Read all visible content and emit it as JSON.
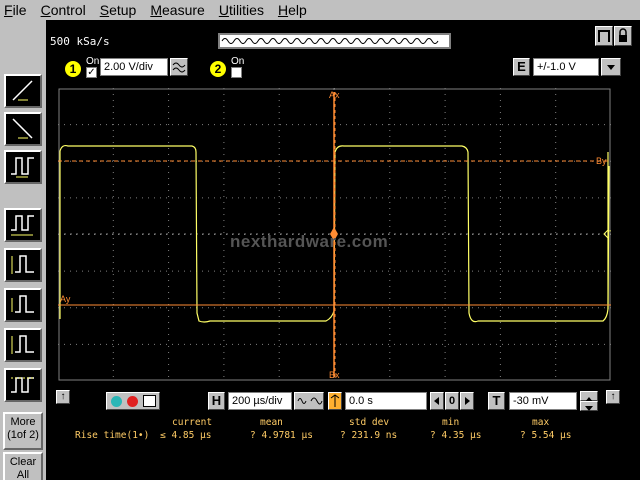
{
  "menu": {
    "file": "File",
    "file_u": "F",
    "control": "Control",
    "control_u": "C",
    "setup": "Setup",
    "setup_u": "S",
    "measure": "Measure",
    "measure_u": "M",
    "utilities": "Utilities",
    "utilities_u": "U",
    "help": "Help",
    "help_u": "H"
  },
  "sample_rate": "500 kSa/s",
  "channel1": {
    "number": "1",
    "on_label": "On",
    "checked": "✓",
    "scale": "2.00 V/div"
  },
  "channel2": {
    "number": "2",
    "on_label": "On"
  },
  "ext_trigger": {
    "button": "E",
    "value": "+/-1.0 V"
  },
  "scope_labels": {
    "ax": "Ax",
    "bx": "Bx",
    "ay": "Ay",
    "by": "By",
    "trig": "T"
  },
  "watermark": "nexthardware.com",
  "timebase": {
    "h_button": "H",
    "scale": "200 µs/div",
    "delay": "0.0 s",
    "zero": "0"
  },
  "trigger": {
    "t_button": "T",
    "level": "-30 mV"
  },
  "left_buttons": {
    "more": "More",
    "more_sub": "(1of 2)",
    "clear": "Clear",
    "clear_sub": "All",
    "up_arrow": "↑"
  },
  "stats": {
    "headers": {
      "current": "current",
      "mean": "mean",
      "std_dev": "std dev",
      "min": "min",
      "max": "max"
    },
    "row": {
      "label": "Rise time(1•)",
      "current": "≤ 4.85 µs",
      "mean": "? 4.9781 µs",
      "std_dev": "? 231.9 ns",
      "min": "? 4.35 µs",
      "max": "? 5.54 µs"
    }
  },
  "colors": {
    "trace": "#ffff66",
    "marker": "#ff8c33",
    "grid": "#808080",
    "background": "#000000"
  }
}
